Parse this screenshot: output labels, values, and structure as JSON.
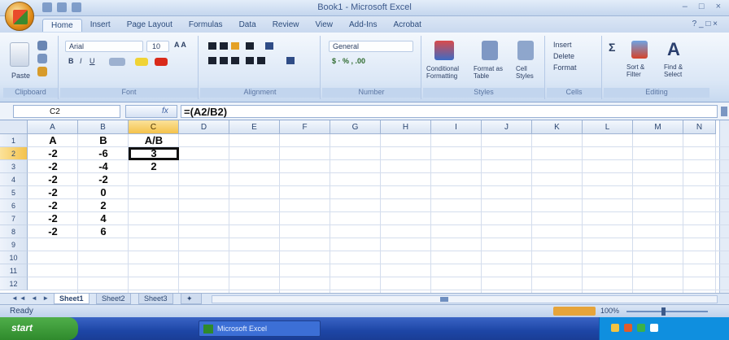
{
  "window": {
    "title": "Book1 - Microsoft Excel",
    "controls": [
      "–",
      "□",
      "×"
    ]
  },
  "ribbon_tabs": [
    "Home",
    "Insert",
    "Page Layout",
    "Formulas",
    "Data",
    "Review",
    "View",
    "Add-Ins",
    "Acrobat"
  ],
  "ribbon_tab_active": "Home",
  "ribbon": {
    "paste_label": "Paste",
    "font_name": "Arial",
    "font_size": "10",
    "number_format": "General",
    "conditional_formatting": "Conditional Formatting",
    "format_as_table": "Format as Table",
    "cell_styles": "Cell Styles",
    "insert": "Insert",
    "delete": "Delete",
    "format": "Format",
    "sort_filter": "Sort & Filter",
    "find_select": "Find & Select",
    "groups": [
      "Clipboard",
      "Font",
      "Alignment",
      "Number",
      "Styles",
      "Cells",
      "Editing"
    ]
  },
  "formula_bar": {
    "name_box": "C2",
    "fx": "fx",
    "formula": "=(A2/B2)"
  },
  "grid": {
    "columns": [
      "A",
      "B",
      "C",
      "D",
      "E",
      "F",
      "G",
      "H",
      "I",
      "J",
      "K",
      "L",
      "M",
      "N"
    ],
    "rows": [
      "1",
      "2",
      "3",
      "4",
      "5",
      "6",
      "7",
      "8",
      "9",
      "10",
      "11",
      "12"
    ],
    "selected_column": "C",
    "selected_row": "2",
    "cells": {
      "A": [
        "A",
        "-2",
        "-2",
        "-2",
        "-2",
        "-2",
        "-2",
        "-2"
      ],
      "B": [
        "B",
        "-6",
        "-4",
        "-2",
        "0",
        "2",
        "4",
        "6"
      ],
      "C": [
        "A/B",
        "3",
        "2"
      ]
    }
  },
  "sheets": {
    "tabs": [
      "Sheet1",
      "Sheet2",
      "Sheet3"
    ],
    "active": "Sheet1"
  },
  "status": {
    "text": "Ready",
    "zoom": "100%"
  },
  "taskbar": {
    "start": "start",
    "item": "Microsoft Excel"
  },
  "colors": {
    "selection_header": "#f4c24c",
    "ribbon_blue": "#c9d9ef",
    "taskbar_blue": "#1d46a6",
    "start_green": "#2f8a2c"
  }
}
